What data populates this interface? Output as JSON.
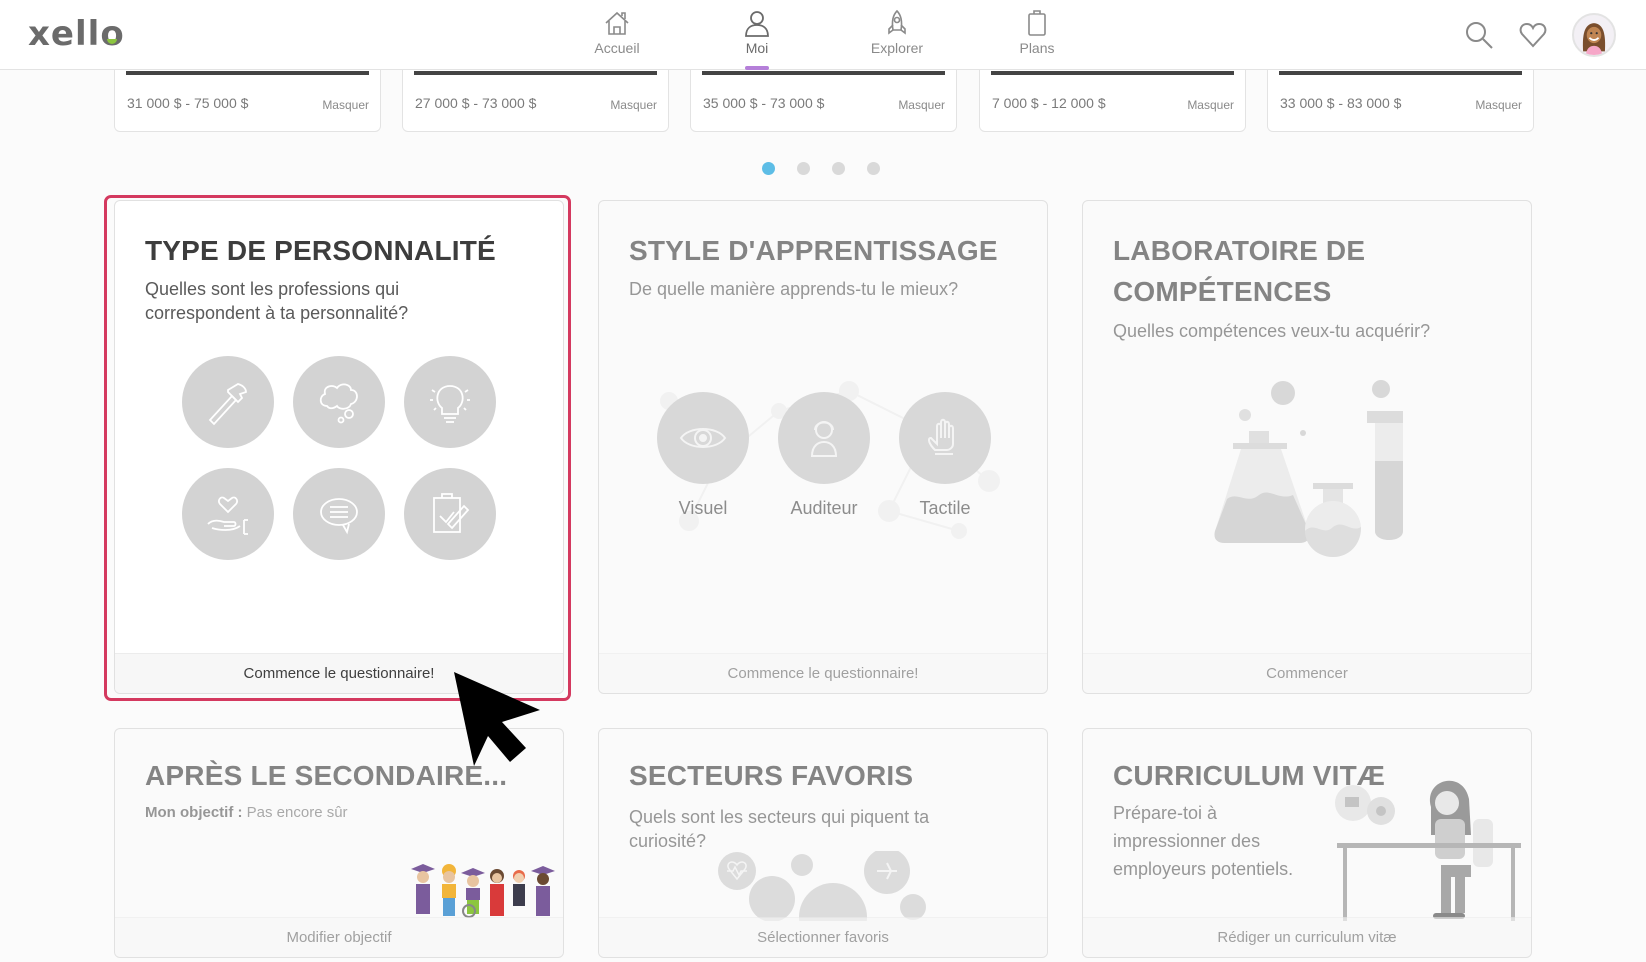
{
  "header": {
    "logo": "xello",
    "nav": [
      {
        "label": "Accueil",
        "icon": "home-icon",
        "active": false
      },
      {
        "label": "Moi",
        "icon": "person-icon",
        "active": true
      },
      {
        "label": "Explorer",
        "icon": "rocket-icon",
        "active": false
      },
      {
        "label": "Plans",
        "icon": "clipboard-icon",
        "active": false
      }
    ],
    "actions": [
      "search-icon",
      "heart-icon",
      "avatar"
    ],
    "accent_color": "#b57fd9"
  },
  "salary_cards": [
    {
      "range": "31 000 $ - 75 000 $",
      "hide_label": "Masquer"
    },
    {
      "range": "27 000 $ - 73 000 $",
      "hide_label": "Masquer"
    },
    {
      "range": "35 000 $ - 73 000 $",
      "hide_label": "Masquer"
    },
    {
      "range": "7 000 $ - 12 000 $",
      "hide_label": "Masquer"
    },
    {
      "range": "33 000 $ - 83 000 $",
      "hide_label": "Masquer"
    }
  ],
  "carousel": {
    "pages": 4,
    "current": 1,
    "active_color": "#5dbde6"
  },
  "cards": {
    "personality": {
      "title": "TYPE DE PERSONNALITÉ",
      "subtitle_line1": "Quelles sont les professions qui",
      "subtitle_line2": "correspondent à ta personnalité?",
      "icons": [
        "hammer-icon",
        "thought-bubble-icon",
        "lightbulb-icon",
        "heart-hand-icon",
        "speech-bubble-icon",
        "clipboard-check-icon"
      ],
      "action": "Commence le questionnaire!",
      "focus_color": "#d4395f"
    },
    "learning": {
      "title": "STYLE D'APPRENTISSAGE",
      "subtitle": "De quelle manière apprends-tu le mieux?",
      "styles": [
        {
          "label": "Visuel",
          "icon": "eye-icon"
        },
        {
          "label": "Auditeur",
          "icon": "headphones-person-icon"
        },
        {
          "label": "Tactile",
          "icon": "hand-icon"
        }
      ],
      "action": "Commence le questionnaire!"
    },
    "skills": {
      "title_line1": "LABORATOIRE DE",
      "title_line2": "COMPÉTENCES",
      "subtitle": "Quelles compétences veux-tu acquérir?",
      "action": "Commencer"
    },
    "after_school": {
      "title": "APRÈS LE SECONDAIRE...",
      "goal_label": "Mon objectif :",
      "goal_value": "Pas encore sûr",
      "action": "Modifier objectif"
    },
    "sectors": {
      "title": "SECTEURS FAVORIS",
      "subtitle_line1": "Quels sont les secteurs qui piquent ta",
      "subtitle_line2": "curiosité?",
      "action": "Sélectionner favoris"
    },
    "resume": {
      "title": "CURRICULUM VITÆ",
      "subtitle_line1": "Prépare-toi à",
      "subtitle_line2": "impressionner des",
      "subtitle_line3": "employeurs potentiels.",
      "action": "Rédiger un curriculum vitæ"
    }
  }
}
